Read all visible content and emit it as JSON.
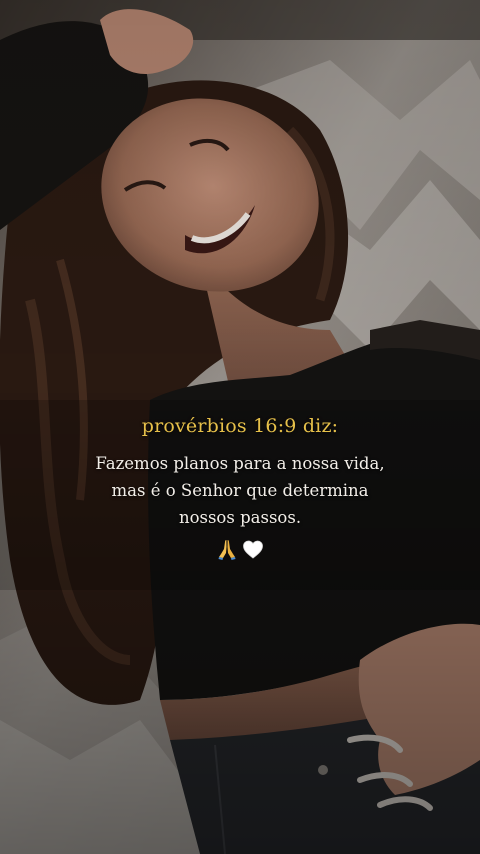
{
  "scene": {
    "icons": [
      "photo-background",
      "praying-hands-icon",
      "white-heart-icon"
    ],
    "colors": {
      "reference_text": "#e6c04a",
      "verse_text": "#f2eee8",
      "shirt": "#141312",
      "hair": "#2b1a12",
      "skin": "#a3745c",
      "blanket": "#8a857f"
    }
  },
  "caption": {
    "reference": "provérbios 16:9 diz:",
    "lines": [
      "Fazemos planos para a nossa vida,",
      "mas é o Senhor que determina",
      "nossos passos."
    ]
  }
}
